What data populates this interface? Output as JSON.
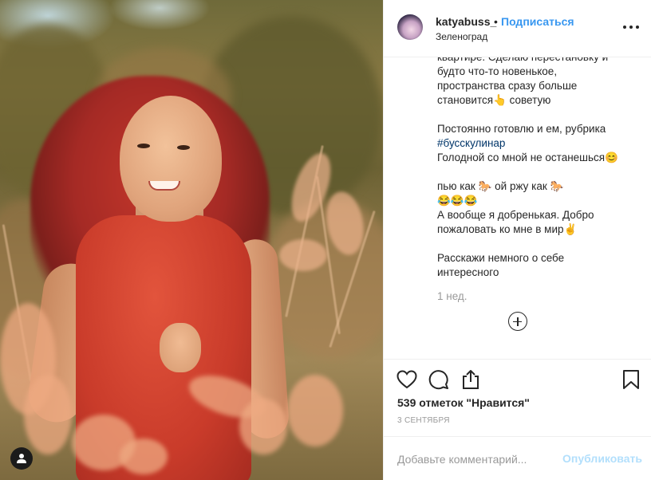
{
  "post": {
    "author": {
      "username": "katyabuss_",
      "separator": "•",
      "follow_label": "Подписаться",
      "location": "Зеленоград"
    },
    "caption_lines": [
      "квартире. Сделаю перестановку и",
      "будто что-то новенькое,",
      "пространства сразу больше",
      "становится👆 советую",
      "",
      "Постоянно готовлю и ем, рубрика",
      "#бусскулинар",
      "Голодной со мной не останешься😊",
      "",
      "пью как 🐎 ой ржу как 🐎",
      "😂😂😂",
      "А вообще я добренькая. Добро",
      "пожаловать ко мне в мир✌",
      "",
      "Расскажи немного о себе",
      "интересного"
    ],
    "hashtag": "#бусскулинар",
    "time_ago": "1 нед.",
    "likes": "539 отметок \"Нравится\"",
    "date": "3 сентября",
    "comment": {
      "placeholder": "Добавьте комментарий...",
      "submit_label": "Опубликовать"
    }
  },
  "icons": {
    "more": "more-options-icon",
    "like": "heart-icon",
    "comment": "comment-icon",
    "share": "share-icon",
    "save": "bookmark-icon",
    "load_more": "plus-circle-icon",
    "user_tag": "person-icon"
  },
  "colors": {
    "link": "#3897f0",
    "publish_disabled": "#b2dffc",
    "hashtag": "#003569",
    "muted": "#999999"
  }
}
